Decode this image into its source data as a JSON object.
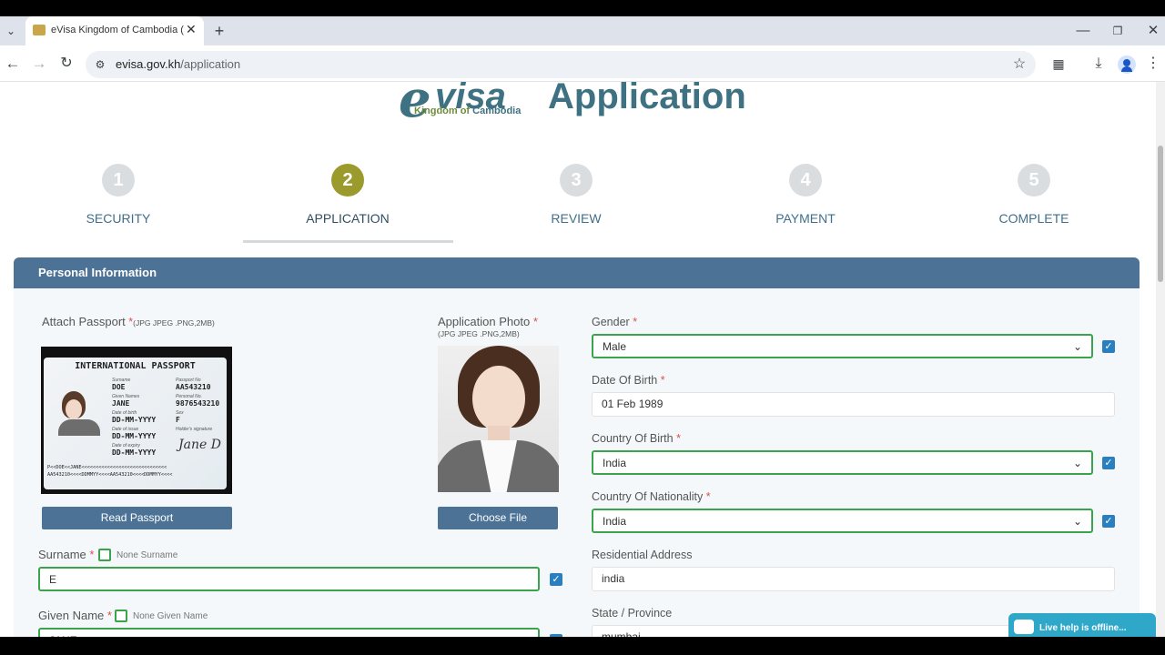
{
  "browser": {
    "tab_title": "eVisa Kingdom of Cambodia (C",
    "url_domain": "evisa.gov.kh",
    "url_path": "/application"
  },
  "header": {
    "logo_e": "e",
    "logo_visa": "visa",
    "logo_kingdom": "Kingdom of",
    "logo_cambodia": "Cambodia",
    "title": "Application"
  },
  "steps": [
    {
      "number": "1",
      "label": "SECURITY"
    },
    {
      "number": "2",
      "label": "APPLICATION"
    },
    {
      "number": "3",
      "label": "REVIEW"
    },
    {
      "number": "4",
      "label": "PAYMENT"
    },
    {
      "number": "5",
      "label": "COMPLETE"
    }
  ],
  "panel": {
    "title": "Personal Information"
  },
  "passport": {
    "label": "Attach Passport",
    "req": "*",
    "formats": "(JPG JPEG .PNG,2MB)",
    "button": "Read Passport",
    "card": {
      "heading": "INTERNATIONAL PASSPORT",
      "surname_cap": "Surname",
      "surname": "DOE",
      "given_cap": "Given Names",
      "given": "JANE",
      "dob_cap": "Date of birth",
      "dob": "DD-MM-YYYY",
      "issue_cap": "Date of issue",
      "issue": "DD-MM-YYYY",
      "expiry_cap": "Date of expiry",
      "expiry": "DD-MM-YYYY",
      "no_cap": "Passport No",
      "no": "AA543210",
      "pno_cap": "Personal No.",
      "pno": "9876543210",
      "sex_cap": "Sex",
      "sex": "F",
      "sig_cap": "Holder's signature",
      "sig": "Jane D",
      "mrz1": "P<<DOE<<JANE<<<<<<<<<<<<<<<<<<<<<<<<<<<<<<",
      "mrz2": "AA543210<<<<DDMMYY<<<<AA543210<<<<DDMMYY<<<<"
    }
  },
  "photo": {
    "label": "Application Photo",
    "req": "*",
    "formats": "(JPG JPEG .PNG,2MB)",
    "button": "Choose File"
  },
  "surname": {
    "label": "Surname",
    "req": "*",
    "none_label": "None Surname",
    "value": "E"
  },
  "given_name": {
    "label": "Given Name",
    "req": "*",
    "none_label": "None Given Name",
    "value": "JANE"
  },
  "gender": {
    "label": "Gender",
    "req": "*",
    "value": "Male"
  },
  "dob": {
    "label": "Date Of Birth",
    "req": "*",
    "value": "01 Feb 1989"
  },
  "country_birth": {
    "label": "Country Of Birth",
    "req": "*",
    "value": "India"
  },
  "country_nationality": {
    "label": "Country Of Nationality",
    "req": "*",
    "value": "India"
  },
  "address": {
    "label": "Residential Address",
    "value": "india"
  },
  "state": {
    "label": "State / Province",
    "value": "mumbai"
  },
  "live_help": {
    "text": "Live help is offline..."
  },
  "colors": {
    "accent": "#4c7296",
    "step_active": "#9b9a2c",
    "valid_border": "#3aa44a",
    "check": "#2b7fbf"
  }
}
